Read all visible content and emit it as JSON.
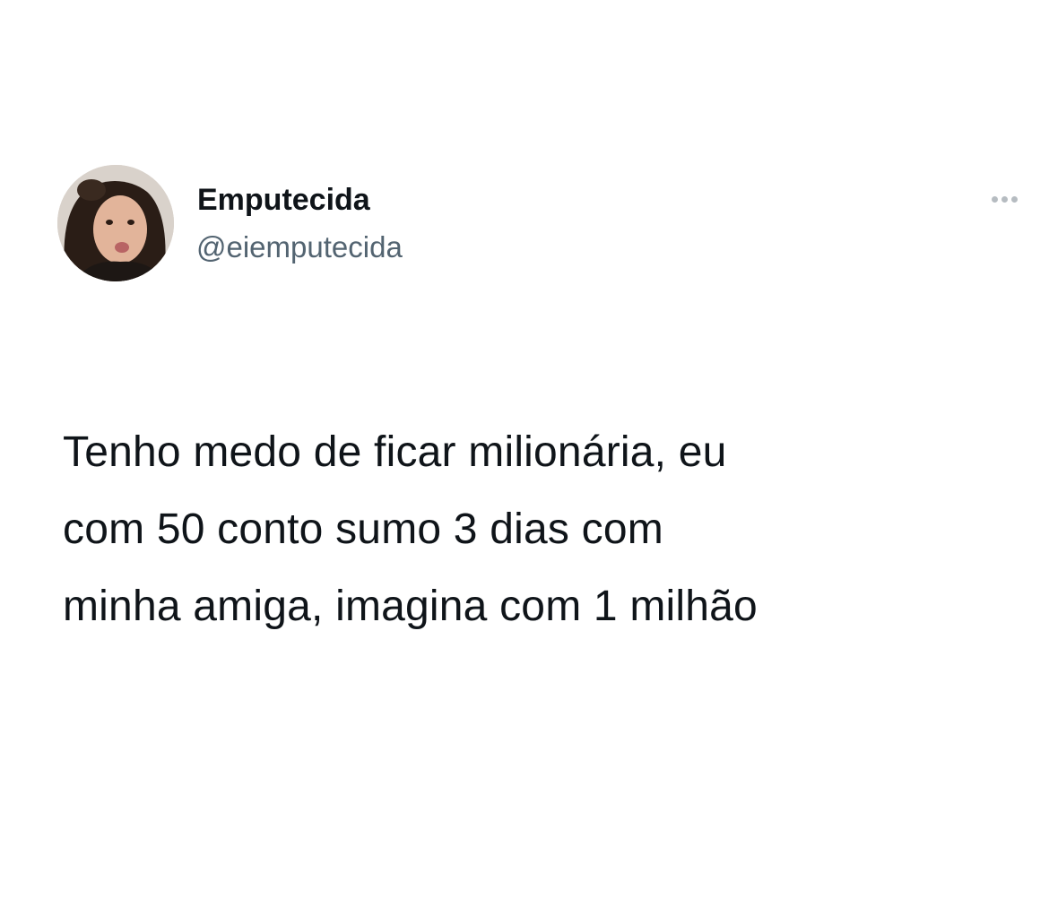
{
  "author": {
    "display_name": "Emputecida",
    "handle": "@eiemputecida",
    "avatar_icon": "user-avatar-photo"
  },
  "tweet": {
    "lines": [
      "Tenho medo de ficar milionária, eu",
      "com 50 conto sumo 3 dias com",
      "minha amiga, imagina com 1 milhão"
    ]
  },
  "actions": {
    "more_icon": "more-options-ellipsis-icon"
  },
  "colors": {
    "background": "#ffffff",
    "primary_text": "#0f1419",
    "secondary_text": "#536471",
    "icon_muted": "#b6bcc1"
  }
}
